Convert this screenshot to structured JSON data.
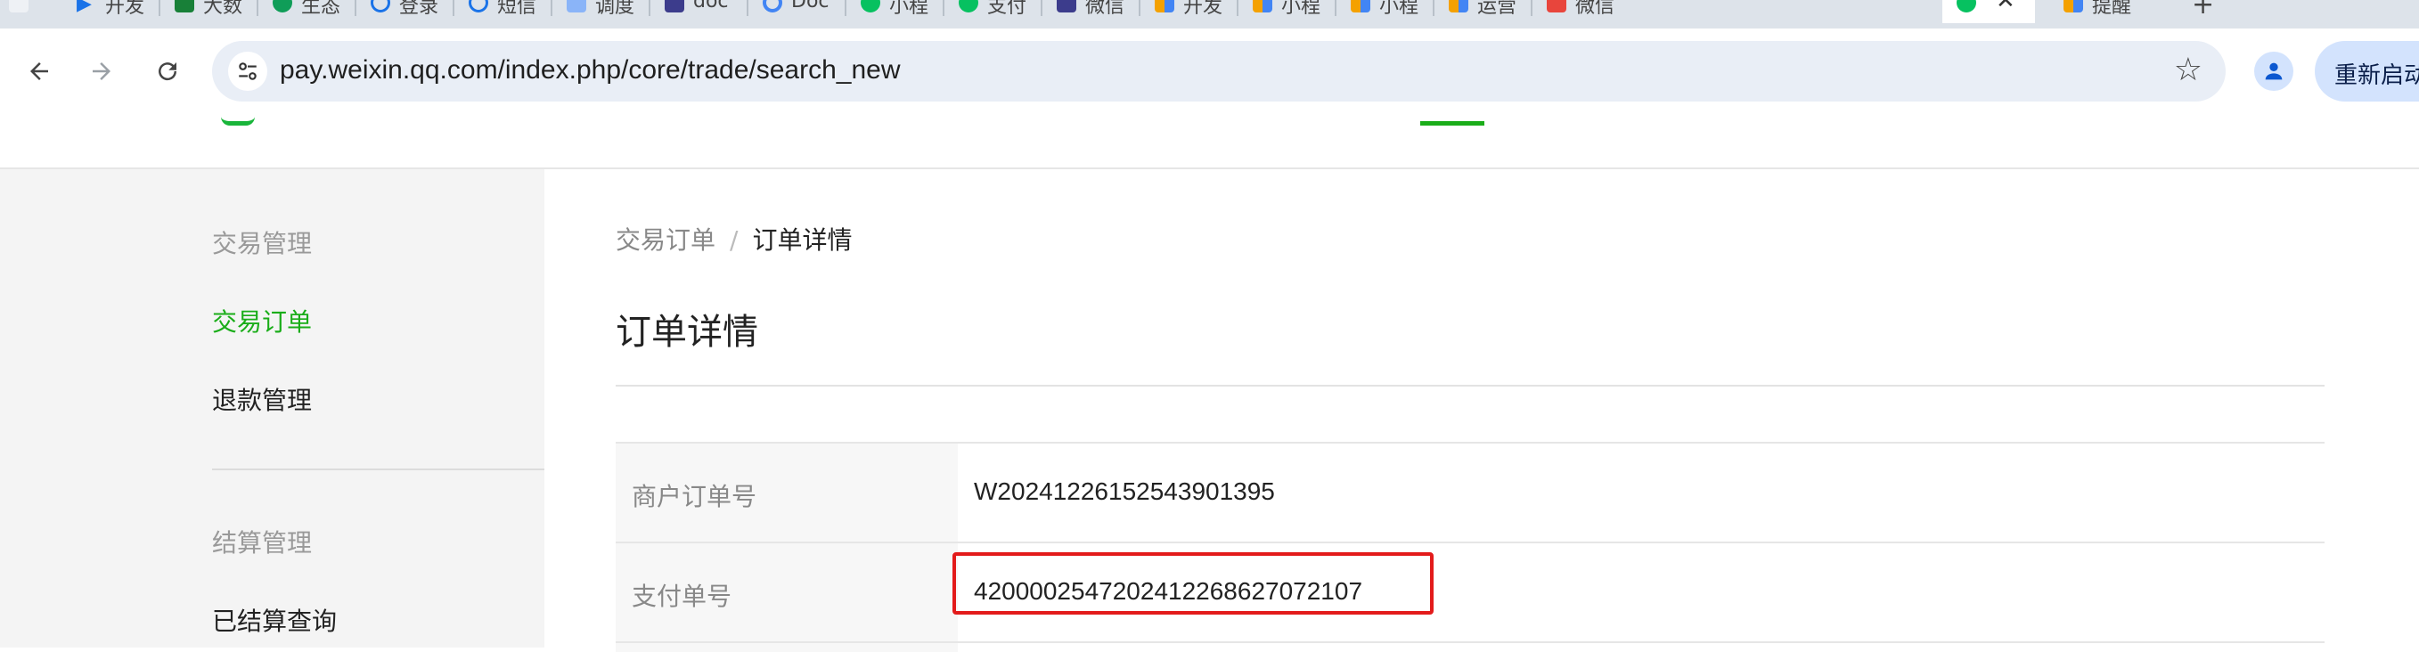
{
  "browser": {
    "tabs": [
      {
        "label": "开发",
        "icon": "play-icon",
        "color": "#1a73e8"
      },
      {
        "label": "大数",
        "icon": "sheet-icon",
        "color": "#188038"
      },
      {
        "label": "生态",
        "icon": "leaf-icon",
        "color": "#0f9d58"
      },
      {
        "label": "登录",
        "icon": "cloud-icon",
        "color": "#1a73e8"
      },
      {
        "label": "短信",
        "icon": "cloud-icon",
        "color": "#1a73e8"
      },
      {
        "label": "调度",
        "icon": "doc-icon",
        "color": "#8ab4f8"
      },
      {
        "label": "doc",
        "icon": "app-icon",
        "color": "#3c3c8c"
      },
      {
        "label": "Doc",
        "icon": "globe-icon",
        "color": "#4285f4"
      },
      {
        "label": "小程",
        "icon": "wechat-icon",
        "color": "#07c160"
      },
      {
        "label": "支付",
        "icon": "wechat-icon",
        "color": "#07c160"
      },
      {
        "label": "微信",
        "icon": "app-icon",
        "color": "#3c3c8c"
      },
      {
        "label": "开发",
        "icon": "shapes-icon",
        "color": "#f4a100"
      },
      {
        "label": "小程",
        "icon": "shapes-icon",
        "color": "#f4a100"
      },
      {
        "label": "小程",
        "icon": "shapes-icon",
        "color": "#f4a100"
      },
      {
        "label": "运营",
        "icon": "shapes-icon",
        "color": "#f4a100"
      },
      {
        "label": "微信",
        "icon": "square-icon",
        "color": "#e8453c"
      },
      {
        "label": "",
        "icon": "wechat-icon",
        "color": "#07c160",
        "active": true
      },
      {
        "label": "提醒",
        "icon": "shapes-icon",
        "color": "#f4a100"
      }
    ],
    "url": "pay.weixin.qq.com/index.php/core/trade/search_new",
    "relaunch_label": "重新启动"
  },
  "sidebar": {
    "group1": "交易管理",
    "items1": [
      "交易订单",
      "退款管理"
    ],
    "group2": "结算管理",
    "items2": [
      "已结算查询"
    ]
  },
  "breadcrumb": {
    "parent": "交易订单",
    "separator": "/",
    "current": "订单详情"
  },
  "page_title": "订单详情",
  "details": [
    {
      "label": "商户订单号",
      "value": "W20241226152543901395"
    },
    {
      "label": "支付单号",
      "value": "4200002547202412268627072107",
      "highlighted": true
    }
  ],
  "colors": {
    "accent": "#1aad19",
    "highlight": "#e31b1b"
  }
}
